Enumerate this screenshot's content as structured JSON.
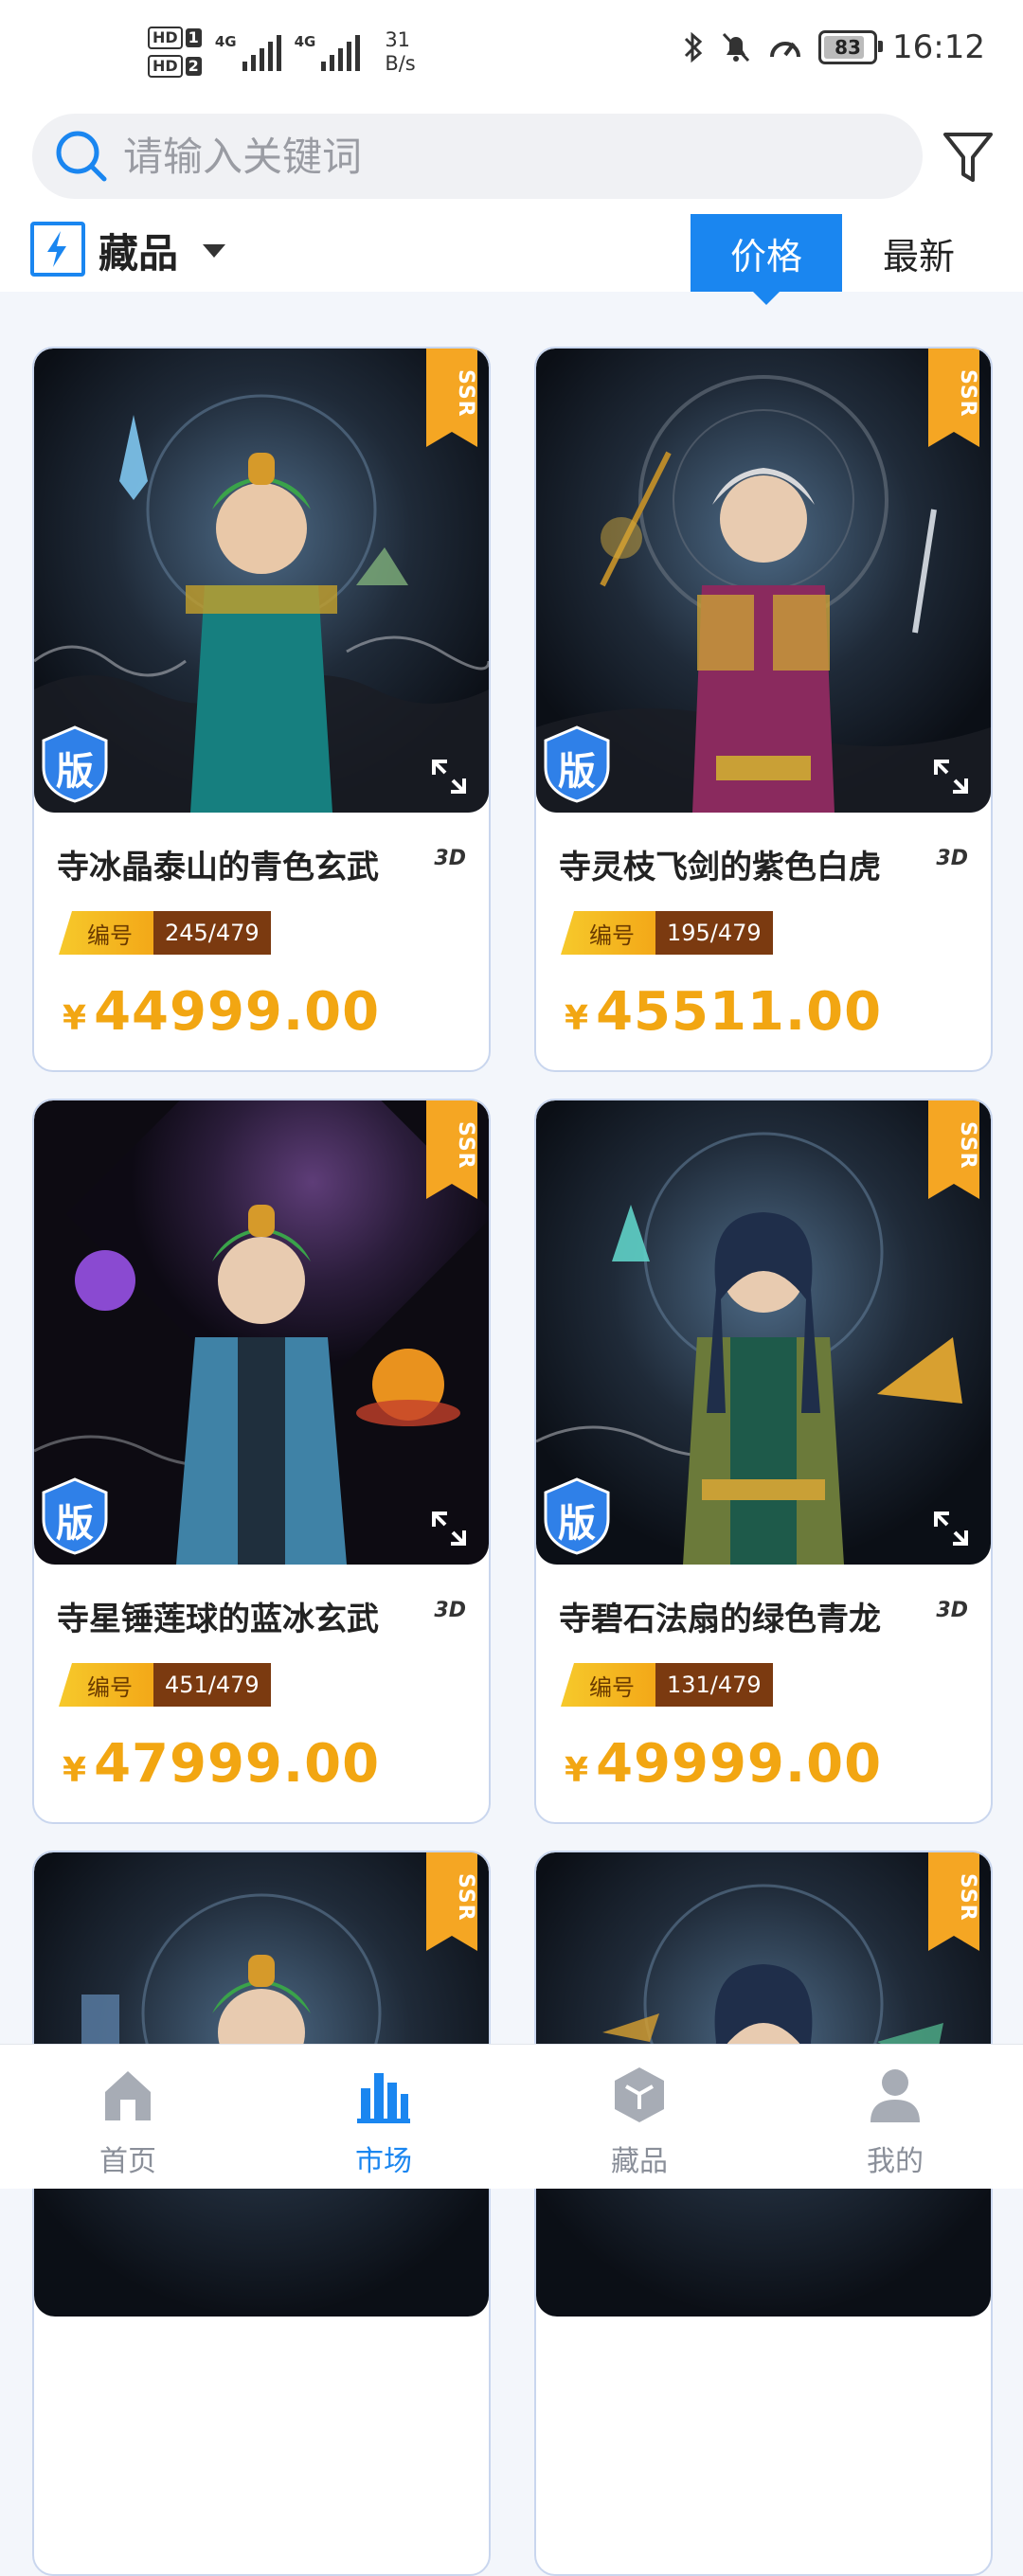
{
  "status_bar": {
    "hd1": "HD",
    "hd1_num": "1",
    "hd2": "HD",
    "hd2_num": "2",
    "net1": "4G",
    "net2": "4G",
    "speed_value": "31",
    "speed_unit": "B/s",
    "battery": "83",
    "time": "16:12"
  },
  "search": {
    "placeholder": "请输入关键词"
  },
  "category": {
    "label": "藏品"
  },
  "sort": {
    "price": "价格",
    "latest": "最新"
  },
  "cards": [
    {
      "title": "寺冰晶泰山的青色玄武",
      "serial_label": "编号",
      "serial": "245/479",
      "currency": "¥",
      "price": "44999.00",
      "rarity": "SSR",
      "edition": "版",
      "tag_3d": "3D"
    },
    {
      "title": "寺灵枝飞剑的紫色白虎",
      "serial_label": "编号",
      "serial": "195/479",
      "currency": "¥",
      "price": "45511.00",
      "rarity": "SSR",
      "edition": "版",
      "tag_3d": "3D"
    },
    {
      "title": "寺星锤莲球的蓝冰玄武",
      "serial_label": "编号",
      "serial": "451/479",
      "currency": "¥",
      "price": "47999.00",
      "rarity": "SSR",
      "edition": "版",
      "tag_3d": "3D"
    },
    {
      "title": "寺碧石法扇的绿色青龙",
      "serial_label": "编号",
      "serial": "131/479",
      "currency": "¥",
      "price": "49999.00",
      "rarity": "SSR",
      "edition": "版",
      "tag_3d": "3D"
    },
    {
      "rarity": "SSR"
    },
    {
      "rarity": "SSR"
    }
  ],
  "nav": [
    {
      "label": "首页",
      "icon": "home-icon"
    },
    {
      "label": "市场",
      "icon": "market-icon",
      "active": true
    },
    {
      "label": "藏品",
      "icon": "collection-cube-icon"
    },
    {
      "label": "我的",
      "icon": "profile-icon"
    }
  ],
  "colors": {
    "accent": "#1a86f0",
    "price": "#f2a612",
    "ssr": "#f5a623",
    "serial_bg": "#7b3a10"
  }
}
